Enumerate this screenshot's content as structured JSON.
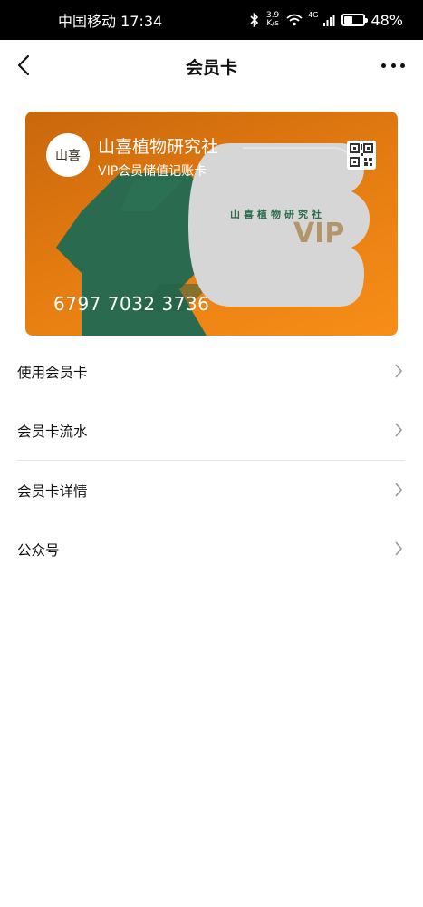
{
  "status_bar": {
    "carrier_time": "中国移动 17:34",
    "net_speed_value": "3.9",
    "net_speed_unit": "K/s",
    "network_type": "4G",
    "battery_percent": "48%",
    "battery_level": 0.48
  },
  "nav": {
    "title": "会员卡"
  },
  "card": {
    "logo_text": "山喜",
    "title": "山喜植物研究社",
    "subtitle": "VIP会员储值记账卡",
    "brand_text": "山喜植物研究社",
    "vip_text": "VIP",
    "number": "6797 7032 3736",
    "colors": {
      "orange": "#e27a10",
      "green": "#2a6b4f",
      "gray": "#d6d6d6"
    }
  },
  "menu": {
    "items": [
      {
        "label": "使用会员卡"
      },
      {
        "label": "会员卡流水"
      },
      {
        "label": "会员卡详情"
      },
      {
        "label": "公众号"
      }
    ]
  }
}
